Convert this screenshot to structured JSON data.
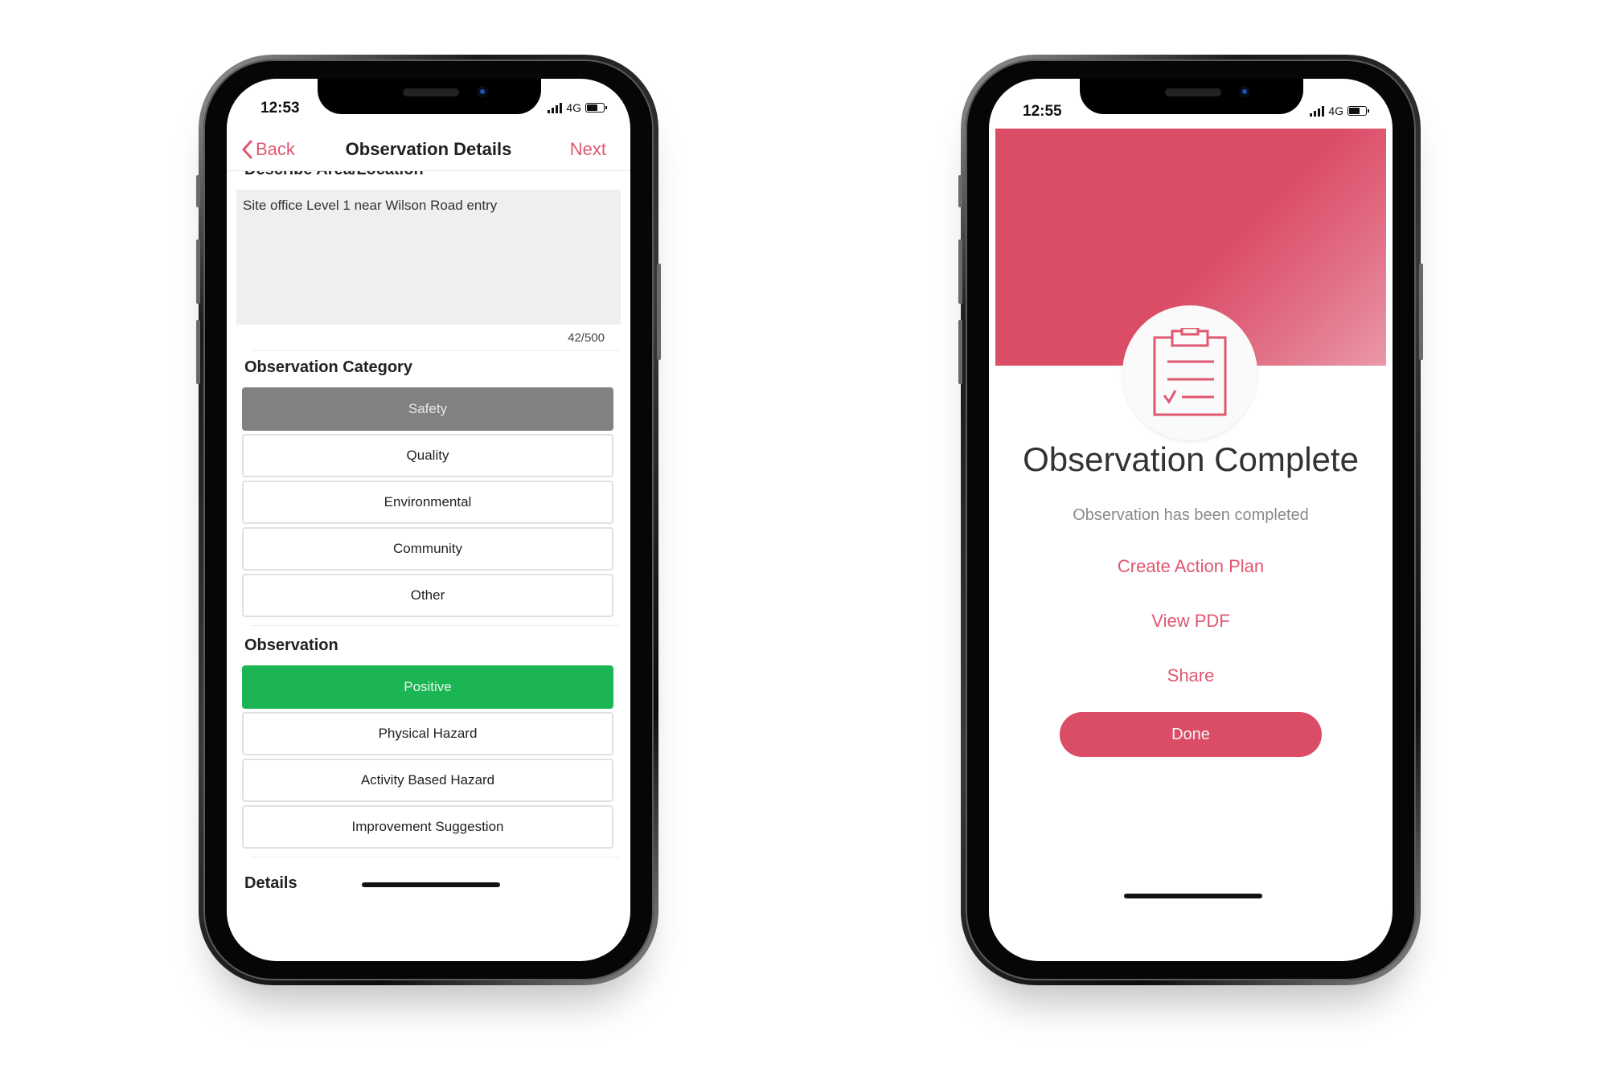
{
  "left_phone": {
    "status_bar": {
      "time": "12:53",
      "network": "4G"
    },
    "nav": {
      "back_label": "Back",
      "title": "Observation Details",
      "next_label": "Next"
    },
    "location_section": {
      "label": "Describe Area/Location",
      "value": "Site office Level 1 near Wilson Road entry",
      "counter": "42/500"
    },
    "category_section": {
      "label": "Observation Category",
      "options": [
        "Safety",
        "Quality",
        "Environmental",
        "Community",
        "Other"
      ],
      "selected": "Safety"
    },
    "observation_section": {
      "label": "Observation",
      "options": [
        "Positive",
        "Physical Hazard",
        "Activity Based Hazard",
        "Improvement Suggestion"
      ],
      "selected": "Positive"
    },
    "details_section": {
      "label": "Details"
    }
  },
  "right_phone": {
    "status_bar": {
      "time": "12:55",
      "network": "4G"
    },
    "icon": "clipboard-check-icon",
    "title": "Observation Complete",
    "subtitle": "Observation has been completed",
    "actions": [
      "Create Action Plan",
      "View PDF",
      "Share"
    ],
    "done_label": "Done"
  },
  "colors": {
    "accent": "#db4c67",
    "link": "#e05770",
    "selected_gray": "#818181",
    "selected_green": "#1cb553",
    "textarea_bg": "#efefef"
  }
}
